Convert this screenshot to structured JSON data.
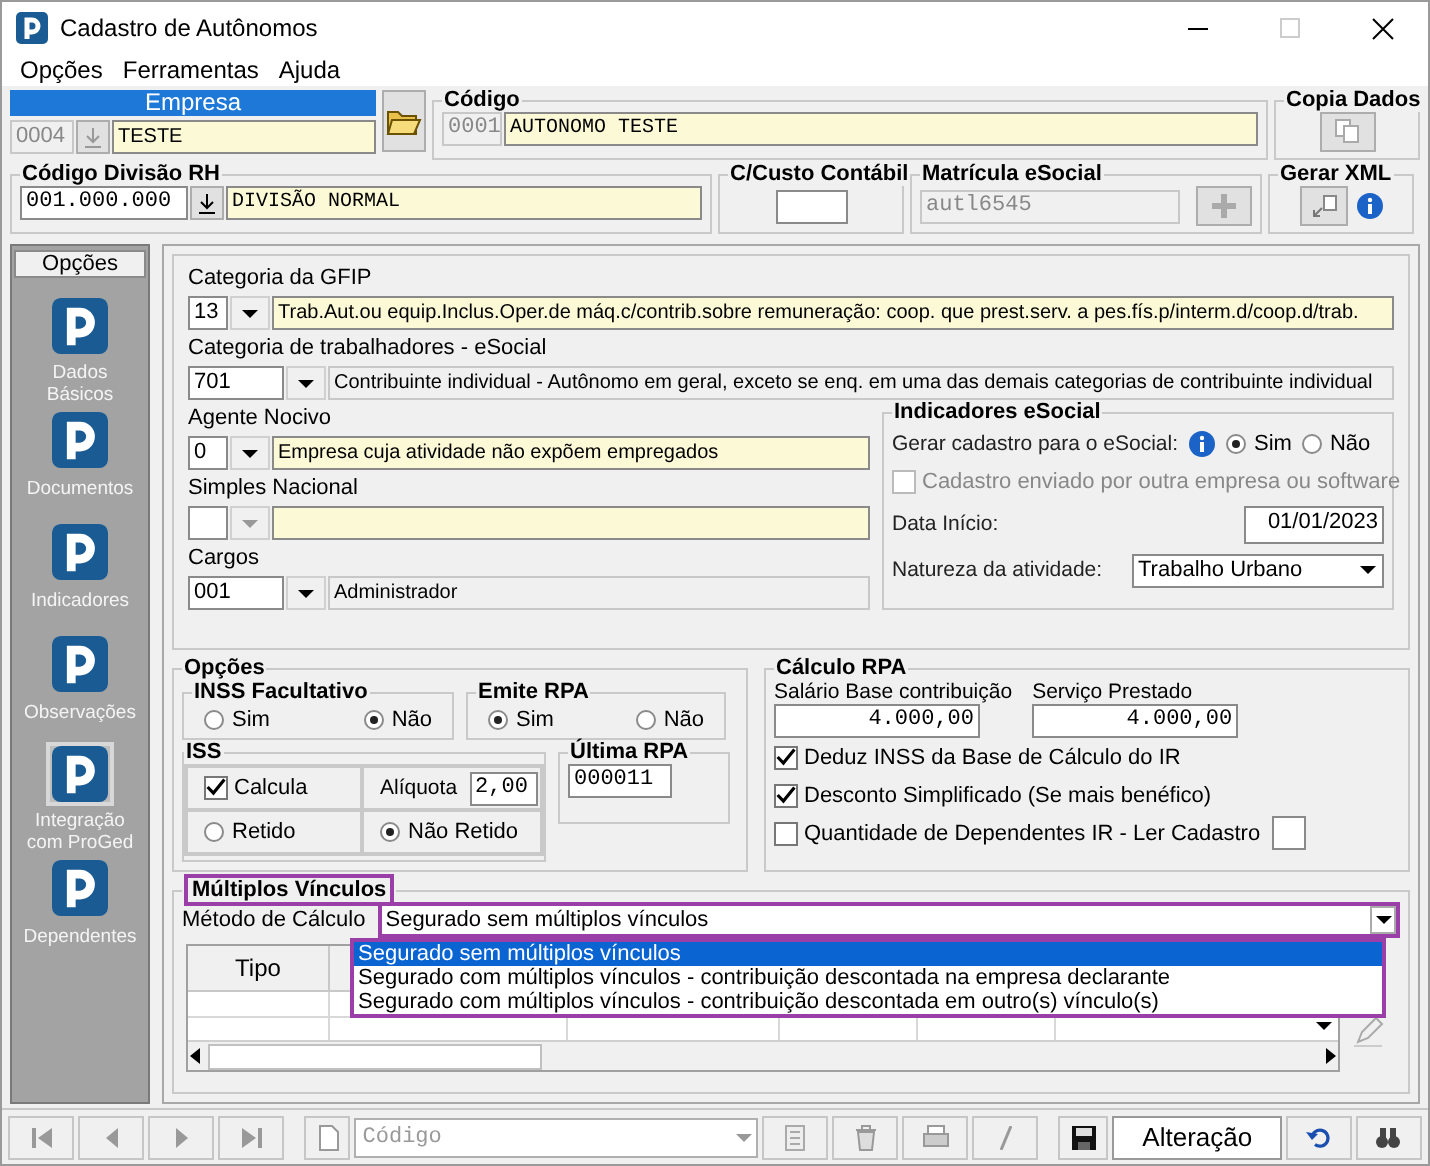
{
  "window": {
    "title": "Cadastro de Autônomos"
  },
  "menu": [
    {
      "label": "Opções"
    },
    {
      "label": "Ferramentas"
    },
    {
      "label": "Ajuda"
    }
  ],
  "empresa": {
    "label": "Empresa",
    "code": "0004",
    "name": "TESTE"
  },
  "codigo": {
    "label": "Código",
    "code": "0001",
    "name": "AUTONOMO TESTE"
  },
  "copia_dados": {
    "label": "Copia Dados"
  },
  "divisao": {
    "label": "Código Divisão RH",
    "code": "001.000.000",
    "name": "DIVISÃO NORMAL"
  },
  "centro_custo": {
    "label": "C/Custo Contábil"
  },
  "matricula": {
    "label": "Matrícula eSocial",
    "value": "autl6545",
    "disabled": true
  },
  "gerar_xml": {
    "label": "Gerar XML"
  },
  "sidebar": {
    "header": "Opções",
    "items": [
      {
        "label": "Dados Básicos",
        "selected": false
      },
      {
        "label": "Documentos",
        "selected": false
      },
      {
        "label": "Indicadores",
        "selected": false
      },
      {
        "label": "Observações",
        "selected": false
      },
      {
        "label": "Integração com ProGed",
        "selected": true
      },
      {
        "label": "Dependentes",
        "selected": false
      }
    ]
  },
  "categories": [
    {
      "label": "Categoria da GFIP",
      "code": "13",
      "description": "Trab.Aut.ou equip.Inclus.Oper.de máq.c/contrib.sobre remuneração: coop. que prest.serv. a pes.fís.p/interm.d/coop.d/trab.",
      "editable": true,
      "disabled": false
    },
    {
      "label": "Categoria de trabalhadores - eSocial",
      "code": "701",
      "description": "Contribuinte individual - Autônomo em geral, exceto se enq. em uma das demais categorias de contribuinte individual",
      "editable": false,
      "disabled": false
    }
  ],
  "details": [
    {
      "label": "Agente  Nocivo",
      "code": "0",
      "description": "Empresa cuja atividade não expõem empregados",
      "editable": true,
      "disabled": false
    },
    {
      "label": "Simples Nacional",
      "editable": true,
      "disabled": true
    },
    {
      "label": "Cargos",
      "code": "001",
      "description": "Administrador",
      "editable": false,
      "disabled": false
    }
  ],
  "indicadores": {
    "title": "Indicadores eSocial",
    "gerar_label": "Gerar cadastro para o eSocial:",
    "options": [
      {
        "label": "Sim",
        "selected": true
      },
      {
        "label": "Não",
        "selected": false
      }
    ],
    "enviado": {
      "label": "Cadastro enviado por outra empresa ou software",
      "checked": false,
      "disabled": true
    },
    "data_inicio": {
      "label": "Data Início:",
      "value": "01/01/2023"
    },
    "natureza": {
      "label": "Natureza da atividade:",
      "value": "Trabalho Urbano"
    }
  },
  "opcoes": {
    "title": "Opções",
    "inss": {
      "title": "INSS Facultativo",
      "options": [
        {
          "label": "Sim",
          "selected": false
        },
        {
          "label": "Não",
          "selected": true
        }
      ]
    },
    "emite_rpa": {
      "title": "Emite RPA",
      "options": [
        {
          "label": "Sim",
          "selected": true
        },
        {
          "label": "Não",
          "selected": false
        }
      ]
    },
    "iss": {
      "title": "ISS",
      "calcula": {
        "label": "Calcula",
        "checked": true
      },
      "aliquota": {
        "label": "Alíquota",
        "value": "2,00"
      },
      "options": [
        {
          "label": "Retido",
          "selected": false
        },
        {
          "label": "Não Retido",
          "selected": true
        }
      ]
    },
    "ultima_rpa": {
      "title": "Última RPA",
      "value": "000011"
    }
  },
  "calculo_rpa": {
    "title": "Cálculo RPA",
    "fields": [
      {
        "label": "Salário Base contribuição",
        "value": "4.000,00"
      },
      {
        "label": "Serviço Prestado",
        "value": "4.000,00"
      }
    ],
    "checks": [
      {
        "kind": "check",
        "label": "Deduz INSS da Base de Cálculo do IR",
        "checked": true
      },
      {
        "kind": "check",
        "label": "Desconto Simplificado (Se mais benéfico)",
        "checked": true
      },
      {
        "kind": "check_input",
        "label": "Quantidade de Dependentes IR - Ler Cadastro",
        "checked": false
      }
    ]
  },
  "multiplos": {
    "title": "Múltiplos Vínculos",
    "metodo_label": "Método de Cálculo",
    "metodo_value": "Segurado sem múltiplos vínculos",
    "options": [
      {
        "label": "Segurado sem múltiplos vínculos",
        "selected": true
      },
      {
        "label": "Segurado com múltiplos vínculos - contribuição descontada na empresa declarante",
        "selected": false
      },
      {
        "label": "Segurado com múltiplos vínculos - contribuição descontada em outro(s) vínculo(s)",
        "selected": false
      }
    ],
    "table": {
      "columns": [
        "Tipo"
      ]
    }
  },
  "toolbar": {
    "search_placeholder": "Código",
    "mode": "Alteração"
  }
}
